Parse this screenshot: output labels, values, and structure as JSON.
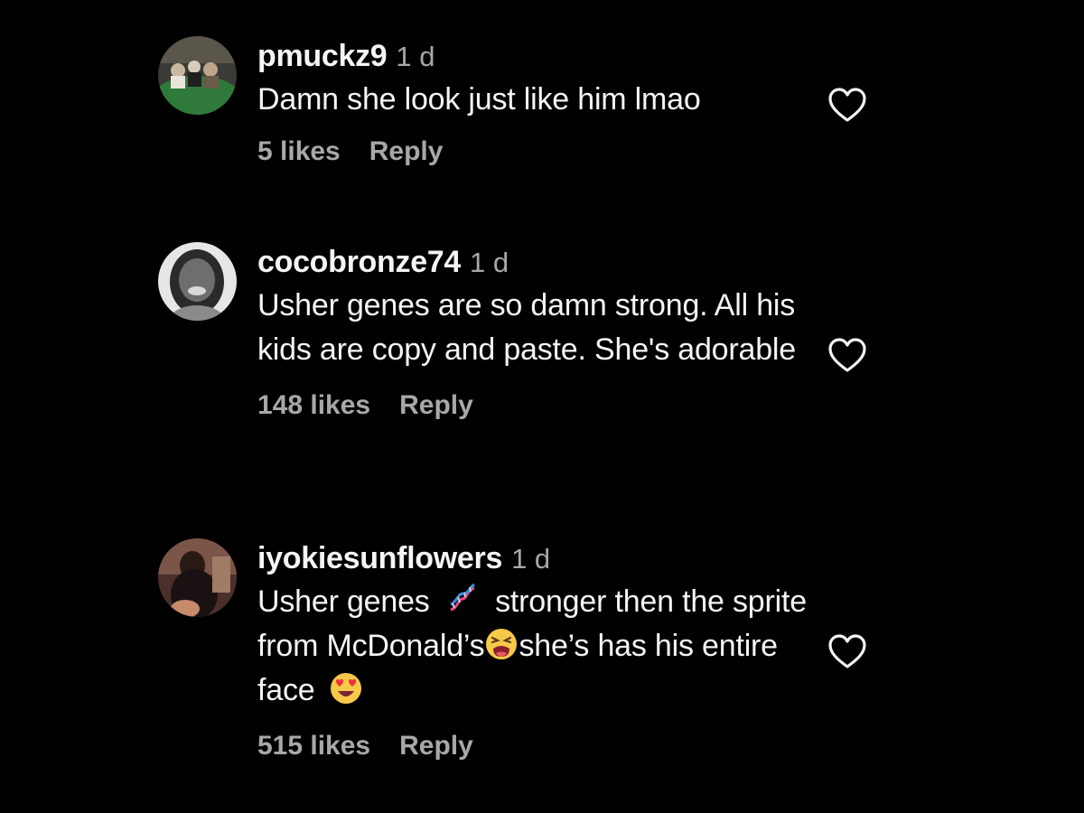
{
  "colors": {
    "background": "#000000",
    "primary_text": "#f5f5f5",
    "secondary_text": "#a8a8a8",
    "heart_outline": "#f5f5f5"
  },
  "comments": [
    {
      "username": "pmuckz9",
      "time": "1 d",
      "text": "Damn she look just like him lmao",
      "likes": "5 likes",
      "reply_label": "Reply",
      "like_icon": "heart-outline-icon"
    },
    {
      "username": "cocobronze74",
      "time": "1 d",
      "text": "Usher genes are so damn strong. All his kids are copy and paste. She's adorable",
      "likes": "148 likes",
      "reply_label": "Reply",
      "like_icon": "heart-outline-icon"
    },
    {
      "username": "iyokiesunflowers",
      "time": "1 d",
      "text_parts": {
        "a": "Usher genes",
        "b": "stronger then the sprite from McDonald’s",
        "c": "she’s has his entire face"
      },
      "emojis": [
        "dna-emoji",
        "tired-face-emoji",
        "heart-eyes-emoji"
      ],
      "likes": "515 likes",
      "reply_label": "Reply",
      "like_icon": "heart-outline-icon"
    }
  ]
}
